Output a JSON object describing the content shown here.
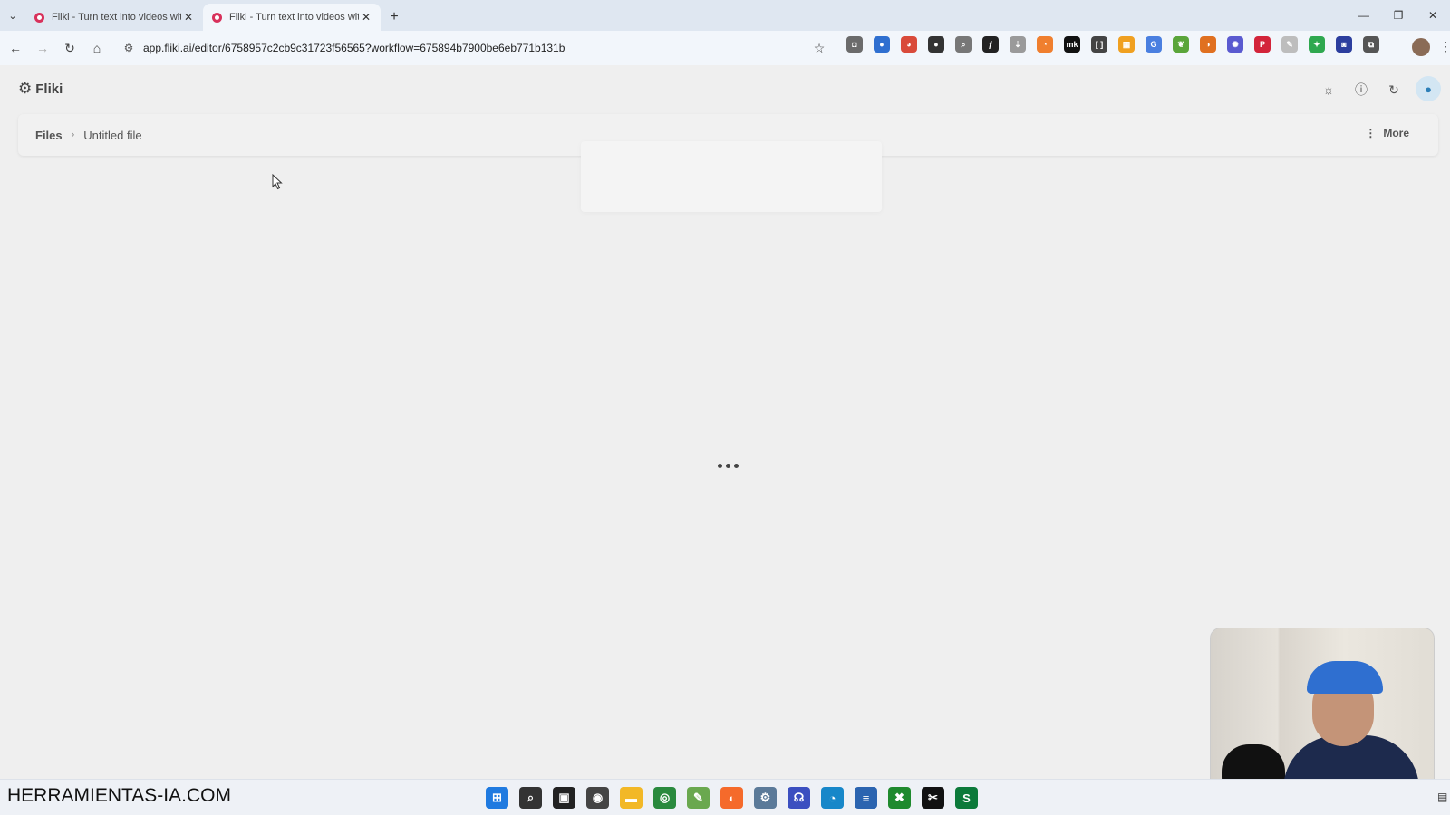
{
  "browser": {
    "tabs": [
      {
        "title": "Fliki - Turn text into videos with",
        "active": false
      },
      {
        "title": "Fliki - Turn text into videos with",
        "active": true
      }
    ],
    "tab_close_glyph": "✕",
    "new_tab_glyph": "+",
    "window_controls": [
      "—",
      "❐",
      "✕"
    ],
    "url": "app.fliki.ai/editor/6758957c2cb9c31723f56565?workflow=675894b7900be6eb771b131b",
    "extensions": [
      {
        "icon": "camera-icon",
        "color": "#6b6b6b",
        "glyph": "◘"
      },
      {
        "icon": "extension-blue-icon",
        "color": "#2f6fd0",
        "glyph": "●"
      },
      {
        "icon": "color-wheel-icon",
        "color": "#d94a3a",
        "glyph": "◕"
      },
      {
        "icon": "dark-circle-icon",
        "color": "#333333",
        "glyph": "●"
      },
      {
        "icon": "search-ext-icon",
        "color": "#777777",
        "glyph": "⌕"
      },
      {
        "icon": "font-icon",
        "color": "#222222",
        "glyph": "ƒ"
      },
      {
        "icon": "pin-icon",
        "color": "#9a9a9a",
        "glyph": "⇣"
      },
      {
        "icon": "orange-ext-icon",
        "color": "#f07f2e",
        "glyph": "◔"
      },
      {
        "icon": "mk-icon",
        "color": "#111111",
        "glyph": "mk"
      },
      {
        "icon": "bracket-icon",
        "color": "#444444",
        "glyph": "[ ]"
      },
      {
        "icon": "calendar-badge-icon",
        "color": "#f0a020",
        "glyph": "▦"
      },
      {
        "icon": "translate-icon",
        "color": "#4a7fe0",
        "glyph": "G"
      },
      {
        "icon": "leaf-icon",
        "color": "#5aa53a",
        "glyph": "❦"
      },
      {
        "icon": "orbit-icon",
        "color": "#e07020",
        "glyph": "◑"
      },
      {
        "icon": "gear-ext-icon",
        "color": "#5a5ad0",
        "glyph": "✺"
      },
      {
        "icon": "pinterest-icon",
        "color": "#d3243a",
        "glyph": "P"
      },
      {
        "icon": "pen-icon",
        "color": "#bdbdbd",
        "glyph": "✎"
      },
      {
        "icon": "sparkle-icon",
        "color": "#2fa84f",
        "glyph": "✦"
      },
      {
        "icon": "shield-ext-icon",
        "color": "#2c3e9e",
        "glyph": "◙"
      },
      {
        "icon": "puzzle-icon",
        "color": "#555555",
        "glyph": "⧉"
      }
    ]
  },
  "app": {
    "logo_text": "Fliki",
    "breadcrumb": {
      "root": "Files",
      "separator": "›",
      "current": "Untitled file"
    },
    "more_label": "More",
    "header_icons": [
      "sun-icon",
      "help-icon",
      "refresh-icon",
      "user-avatar"
    ]
  },
  "overlay": {
    "watermark": "HERRAMIENTAS-IA.COM"
  },
  "taskbar": {
    "icons": [
      {
        "icon": "windows-start-icon",
        "color": "#1f7ae0",
        "glyph": "⊞"
      },
      {
        "icon": "search-icon",
        "color": "#333333",
        "glyph": "⌕"
      },
      {
        "icon": "task-view-icon",
        "color": "#222222",
        "glyph": "▣"
      },
      {
        "icon": "davinci-icon",
        "color": "#444444",
        "glyph": "◉"
      },
      {
        "icon": "file-explorer-icon",
        "color": "#f2b827",
        "glyph": "▬"
      },
      {
        "icon": "chrome-icon",
        "color": "#2a8a3e",
        "glyph": "◎"
      },
      {
        "icon": "notepad-icon",
        "color": "#6aa84f",
        "glyph": "✎"
      },
      {
        "icon": "firefox-icon",
        "color": "#f56a2b",
        "glyph": "◐"
      },
      {
        "icon": "settings-icon",
        "color": "#5b7a99",
        "glyph": "⚙"
      },
      {
        "icon": "headphones-icon",
        "color": "#3b4fc0",
        "glyph": "☊"
      },
      {
        "icon": "edge-icon",
        "color": "#1787c9",
        "glyph": "◔"
      },
      {
        "icon": "notes-icon",
        "color": "#2b64b0",
        "glyph": "≡"
      },
      {
        "icon": "xbox-icon",
        "color": "#1f8a2e",
        "glyph": "✖"
      },
      {
        "icon": "capcut-icon",
        "color": "#111111",
        "glyph": "✂"
      },
      {
        "icon": "app-s-icon",
        "color": "#0c7a3a",
        "glyph": "S"
      }
    ]
  }
}
